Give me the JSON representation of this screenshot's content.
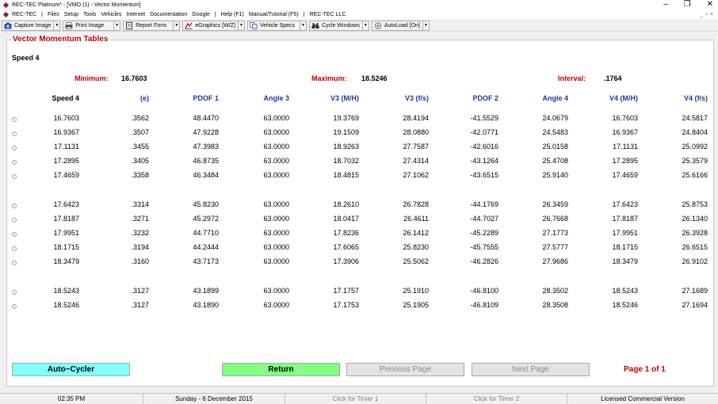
{
  "window": {
    "title": "REC-TEC Platinum* - [VMO (1) - Vector Momentum]",
    "controls": [
      "–",
      "❐",
      "✕"
    ]
  },
  "menu": {
    "items": [
      "REC-TEC",
      "|",
      "Files",
      "Setup",
      "Tools",
      "Vehicles",
      "Internet",
      "Documentation",
      "Google",
      "|",
      "Help (F1)",
      "Manual/Tutorial (F5)",
      "|",
      "REC-TEC LLC"
    ],
    "mdi_controls": "_ ♂ ×"
  },
  "toolbar": {
    "buttons": [
      {
        "label": "Capture Image",
        "icon": "camera-icon"
      },
      {
        "label": "Print Image",
        "icon": "printer-icon"
      },
      {
        "label": "Report Form",
        "icon": "report-icon"
      },
      {
        "label": "eGraphics [W/Z]",
        "icon": "graphics-icon"
      },
      {
        "label": "Vehicle Specs",
        "icon": "specs-icon"
      },
      {
        "label": "Cycle Windows",
        "icon": "binoculars-icon"
      },
      {
        "label": "AutoLoad [On]",
        "icon": "gear-icon"
      }
    ]
  },
  "panel": {
    "legend": "Vector Momentum Tables",
    "heading": "Speed 4",
    "summary": {
      "min_label": "Minimum:",
      "min_value": "16.7603",
      "max_label": "Maximum:",
      "max_value": "18.5246",
      "interval_label": "Interval:",
      "interval_value": ".1764"
    },
    "columns": [
      "Speed 4",
      "(e)",
      "PDOF 1",
      "Angle 3",
      "V3 (M/H)",
      "V3 (f/s)",
      "PDOF 2",
      "Angle 4",
      "V4 (M/H)",
      "V4 (f/s)"
    ],
    "groups": [
      [
        [
          "16.7603",
          ".3562",
          "48.4470",
          "63.0000",
          "19.3769",
          "28.4194",
          "-41.5529",
          "24.0679",
          "16.7603",
          "24.5817"
        ],
        [
          "16.9367",
          ".3507",
          "47.9228",
          "63.0000",
          "19.1509",
          "28.0880",
          "-42.0771",
          "24.5483",
          "16.9367",
          "24.8404"
        ],
        [
          "17.1131",
          ".3455",
          "47.3983",
          "63.0000",
          "18.9263",
          "27.7587",
          "-42.6016",
          "25.0158",
          "17.1131",
          "25.0992"
        ],
        [
          "17.2895",
          ".3405",
          "46.8735",
          "63.0000",
          "18.7032",
          "27.4314",
          "-43.1264",
          "25.4708",
          "17.2895",
          "25.3579"
        ],
        [
          "17.4659",
          ".3358",
          "46.3484",
          "63.0000",
          "18.4815",
          "27.1062",
          "-43.6515",
          "25.9140",
          "17.4659",
          "25.6166"
        ]
      ],
      [
        [
          "17.6423",
          ".3314",
          "45.8230",
          "63.0000",
          "18.2610",
          "26.7828",
          "-44.1769",
          "26.3459",
          "17.6423",
          "25.8753"
        ],
        [
          "17.8187",
          ".3271",
          "45.2972",
          "63.0000",
          "18.0417",
          "26.4611",
          "-44.7027",
          "26.7668",
          "17.8187",
          "26.1340"
        ],
        [
          "17.9951",
          ".3232",
          "44.7710",
          "63.0000",
          "17.8236",
          "26.1412",
          "-45.2289",
          "27.1773",
          "17.9951",
          "26.3928"
        ],
        [
          "18.1715",
          ".3194",
          "44.2444",
          "63.0000",
          "17.6065",
          "25.8230",
          "-45.7555",
          "27.5777",
          "18.1715",
          "26.6515"
        ],
        [
          "18.3479",
          ".3160",
          "43.7173",
          "63.0000",
          "17.3906",
          "25.5062",
          "-46.2826",
          "27.9686",
          "18.3479",
          "26.9102"
        ]
      ],
      [
        [
          "18.5243",
          ".3127",
          "43.1899",
          "63.0000",
          "17.1757",
          "25.1910",
          "-46.8100",
          "28.3502",
          "18.5243",
          "27.1689"
        ],
        [
          "18.5246",
          ".3127",
          "43.1890",
          "63.0000",
          "17.1753",
          "25.1905",
          "-46.8109",
          "28.3508",
          "18.5246",
          "27.1694"
        ]
      ]
    ]
  },
  "buttons": {
    "autocycler": "Auto~Cycler",
    "return": "Return",
    "previous": "Previous Page",
    "next": "Next Page",
    "page_info": "Page  1 of  1",
    "colors": {
      "autocycler": "#80ffff",
      "return": "#80ff80",
      "disabled": "#e3e3e3"
    }
  },
  "status": {
    "time": "02:35 PM",
    "date": "Sunday  -  6 December 2015",
    "timer1": "Click for Timer 1",
    "timer2": "Click for Timer 2",
    "license": "Licensed Commercial Version"
  }
}
